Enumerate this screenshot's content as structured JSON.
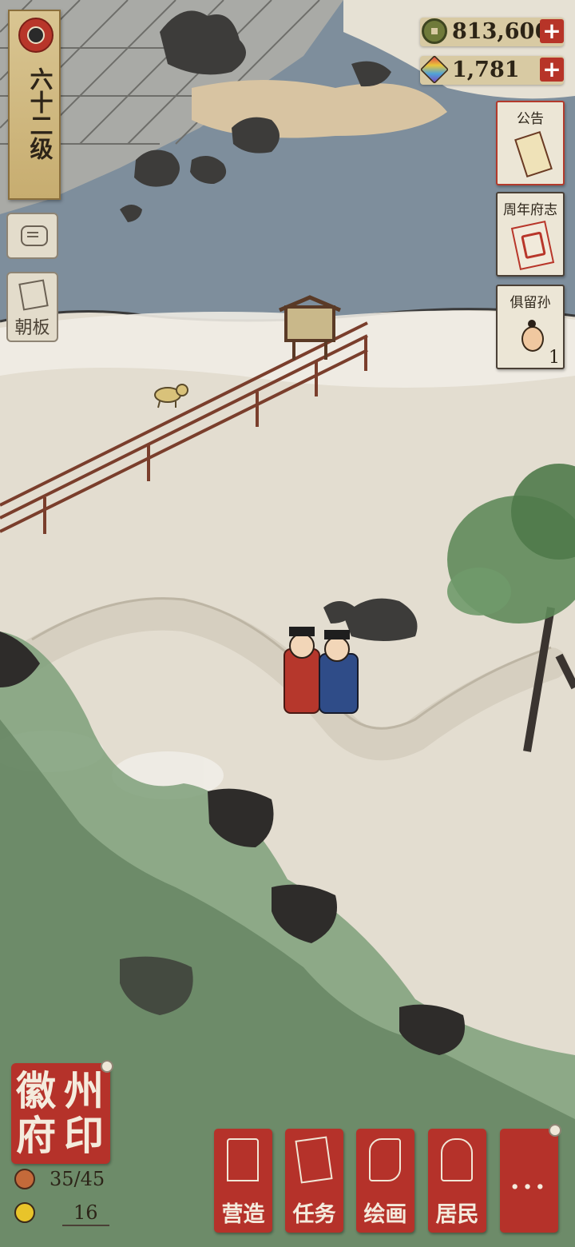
{
  "level": {
    "label": "六十二级"
  },
  "currency": {
    "coins": "813,606",
    "gems": "1,781",
    "plus": "+"
  },
  "side_cards": {
    "announcement": {
      "title": "公告"
    },
    "anniversary": {
      "title": "周年府志"
    },
    "keep": {
      "title": "俱留孙",
      "count": "1"
    }
  },
  "left_buttons": {
    "board": "朝板"
  },
  "seal": {
    "chars": [
      "徽",
      "州",
      "府",
      "印"
    ]
  },
  "stats": {
    "population": "35/45",
    "happiness": "16"
  },
  "nav": {
    "build": "营造",
    "task": "任务",
    "paint": "绘画",
    "resident": "居民",
    "more": "..."
  },
  "colors": {
    "seal_red": "#b5322a",
    "water": "#7d8d9c",
    "paper": "#e3ddd0",
    "foliage": "#6f9a6a"
  },
  "icons": {
    "level": "fan-emblem-icon",
    "coins": "coin-icon",
    "gems": "gem-icon",
    "announcement": "scroll-notice-icon",
    "anniversary": "anniversary-book-icon",
    "keep": "character-face-icon",
    "chat": "chat-bubble-icon",
    "board": "board-tablet-icon",
    "population": "population-icon",
    "happiness": "happy-face-icon",
    "build": "pavilion-icon",
    "task": "task-book-icon",
    "paint": "scroll-painting-icon",
    "resident": "resident-portrait-icon"
  }
}
